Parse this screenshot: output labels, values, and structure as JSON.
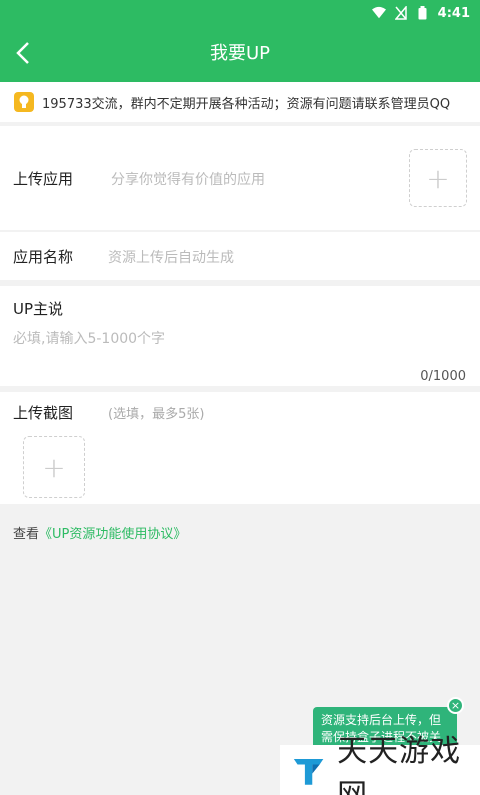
{
  "status": {
    "time": "4:41"
  },
  "appbar": {
    "title": "我要UP"
  },
  "notice": {
    "text": "195733交流，群内不定期开展各种活动；资源有问题请联系管理员QQ"
  },
  "upload_app": {
    "label": "上传应用",
    "hint": "分享你觉得有价值的应用"
  },
  "app_name": {
    "label": "应用名称",
    "hint": "资源上传后自动生成"
  },
  "up_says": {
    "label": "UP主说",
    "placeholder": "必填,请输入5-1000个字",
    "counter": "0/1000"
  },
  "screenshots": {
    "label": "上传截图",
    "hint": "(选填，最多5张)"
  },
  "agreement": {
    "prefix": "查看",
    "link": "《UP资源功能使用协议》"
  },
  "toast": {
    "text": "资源支持后台上传，但需保持盒子进程不被关"
  },
  "watermark": {
    "text": "天天游戏网"
  },
  "colors": {
    "primary": "#2dbb63",
    "notice_icon": "#f5b820"
  }
}
